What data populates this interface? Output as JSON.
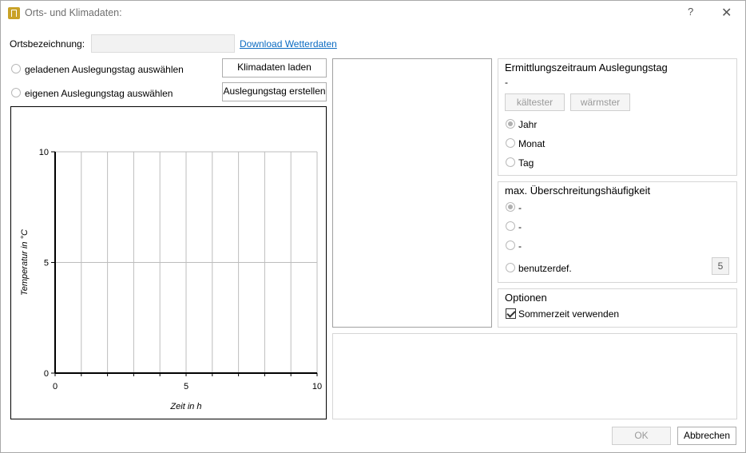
{
  "window": {
    "title": "Orts- und Klimadaten:",
    "help_label": "?",
    "close_label": "✕"
  },
  "location": {
    "label": "Ortsbezeichnung:",
    "value": "",
    "download_link": "Download Wetterdaten"
  },
  "design_day": {
    "option_loaded": "geladenen Auslegungstag auswählen",
    "option_own": "eigenen Auslegungstag auswählen",
    "load_button": "Klimadaten laden",
    "create_button": "Auslegungstag erstellen"
  },
  "period": {
    "title": "Ermittlungszeitraum Auslegungstag",
    "value": "-",
    "coldest_button": "kältester",
    "warmest_button": "wärmster",
    "options": [
      "Jahr",
      "Monat",
      "Tag"
    ],
    "selected": "Jahr"
  },
  "exceedance": {
    "title": "max. Überschreitungshäufigkeit",
    "options": [
      "-",
      "-",
      "-",
      "benutzerdef."
    ],
    "custom_value": "5"
  },
  "options": {
    "title": "Optionen",
    "dst_label": "Sommerzeit verwenden",
    "dst_checked": true
  },
  "footer": {
    "ok_label": "OK",
    "cancel_label": "Abbrechen"
  },
  "chart_data": {
    "type": "line",
    "series": [],
    "xlabel": "Zeit in h",
    "ylabel": "Temperatur in °C",
    "xlim": [
      0,
      10
    ],
    "ylim": [
      0,
      10
    ],
    "xticks": [
      "0",
      "5",
      "10"
    ],
    "yticks": [
      "0",
      "5",
      "10"
    ],
    "grid": true
  }
}
